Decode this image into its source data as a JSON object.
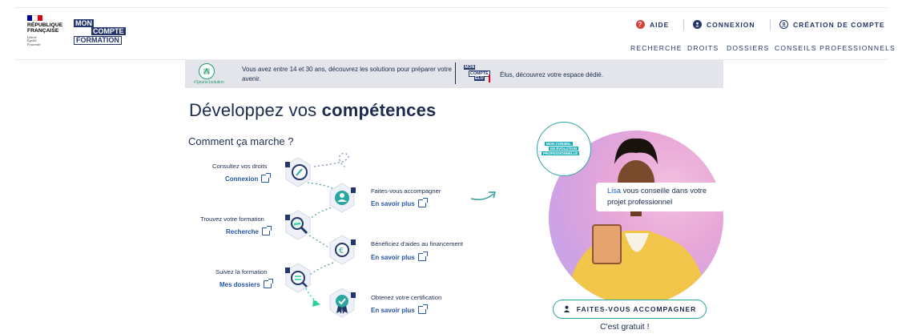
{
  "brand": {
    "republique": [
      "RÉPUBLIQUE",
      "FRANÇAISE"
    ],
    "motto": [
      "Liberté",
      "Égalité",
      "Fraternité"
    ],
    "logo": [
      "MON",
      "COMPTE",
      "FORMATION"
    ]
  },
  "utility_nav": {
    "help": "AIDE",
    "login": "CONNEXION",
    "signup": "CRÉATION DE COMPTE"
  },
  "main_nav": [
    "RECHERCHE",
    "DROITS",
    "DOSSIERS",
    "CONSEILS PROFESSIONNELS"
  ],
  "banner": {
    "jeune_tag": "#1jeune1solution",
    "jeune_text": "Vous avez entre 14 et 30 ans, découvrez les solutions pour préparer votre avenir.",
    "elu_logo": [
      "MON",
      "COMPTE",
      "ÉLU"
    ],
    "elu_text": "Élus, découvrez votre espace dédié."
  },
  "title": {
    "prefix": "Développez vos",
    "bold": "compétences"
  },
  "subtitle": "Comment ça marche ?",
  "steps": [
    {
      "label": "Consultez vos droits",
      "link": "Connexion",
      "icon": "gauge-icon"
    },
    {
      "label": "Faites-vous accompagner",
      "link": "En savoir plus",
      "icon": "person-icon"
    },
    {
      "label": "Trouvez votre formation",
      "link": "Recherche",
      "icon": "magnifier-icon"
    },
    {
      "label": "Bénéficiez d'aides au financement",
      "link": "En savoir plus",
      "icon": "euro-icon"
    },
    {
      "label": "Suivez la formation",
      "link": "Mes dossiers",
      "icon": "checklist-icon"
    },
    {
      "label": "Obtenez votre certification",
      "link": "En savoir plus",
      "icon": "certification-icon"
    }
  ],
  "promo": {
    "badge": [
      "MON CONSEIL",
      "EN ÉVOLUTION",
      "PROFESSIONNELLE"
    ],
    "quote_name": "Lisa",
    "quote_text": "vous conseille dans votre projet professionnel",
    "cta": "FAITES-VOUS ACCOMPAGNER",
    "free": "C'est gratuit !"
  },
  "colors": {
    "navy": "#24356b",
    "accent_blue": "#2556a5",
    "teal": "#2aa6a0",
    "help_red": "#d9413b",
    "flag_blue": "#000091",
    "flag_red": "#e1000f"
  }
}
